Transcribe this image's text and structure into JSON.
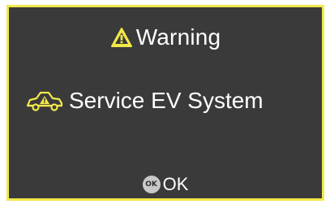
{
  "screen": {
    "title": "Warning",
    "title_icon": "warning-triangle-icon",
    "message": "Service EV System",
    "message_icon": "ev-vehicle-fault-icon",
    "confirm_badge": "OK",
    "confirm_label": "OK"
  },
  "colors": {
    "accent": "#f2e84a",
    "background": "#3a3a3a",
    "text": "#ffffff",
    "badge": "#c8c8c8"
  }
}
